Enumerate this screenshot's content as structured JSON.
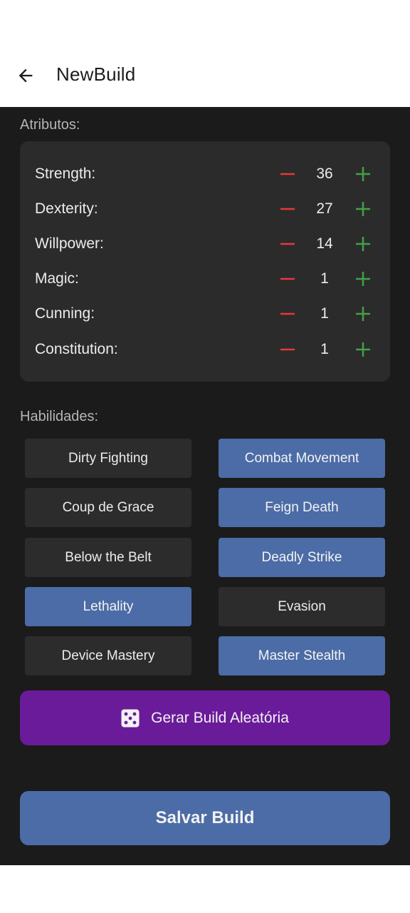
{
  "header": {
    "title": "NewBuild",
    "back_icon": "arrow-left-icon"
  },
  "attributes": {
    "label": "Atributos:",
    "items": [
      {
        "name": "Strength:",
        "value": "36"
      },
      {
        "name": "Dexterity:",
        "value": "27"
      },
      {
        "name": "Willpower:",
        "value": "14"
      },
      {
        "name": "Magic:",
        "value": "1"
      },
      {
        "name": "Cunning:",
        "value": "1"
      },
      {
        "name": "Constitution:",
        "value": "1"
      }
    ]
  },
  "skills": {
    "label": "Habilidades:",
    "items": [
      {
        "name": "Dirty Fighting",
        "selected": false
      },
      {
        "name": "Combat Movement",
        "selected": true
      },
      {
        "name": "Coup de Grace",
        "selected": false
      },
      {
        "name": "Feign Death",
        "selected": true
      },
      {
        "name": "Below the Belt",
        "selected": false
      },
      {
        "name": "Deadly Strike",
        "selected": true
      },
      {
        "name": "Lethality",
        "selected": true
      },
      {
        "name": "Evasion",
        "selected": false
      },
      {
        "name": "Device Mastery",
        "selected": false
      },
      {
        "name": "Master Stealth",
        "selected": true
      }
    ]
  },
  "random_button": {
    "label": "Gerar Build Aleatória",
    "icon": "dice-icon"
  },
  "save_button": {
    "label": "Salvar Build"
  },
  "colors": {
    "minus": "#e53935",
    "plus": "#43a047",
    "selected_skill": "#4b6ca6",
    "unselected_skill": "#2c2c2c",
    "random_button": "#6a1b9a",
    "save_button": "#4b6ca6",
    "background": "#1b1b1b",
    "card": "#2b2b2b"
  }
}
